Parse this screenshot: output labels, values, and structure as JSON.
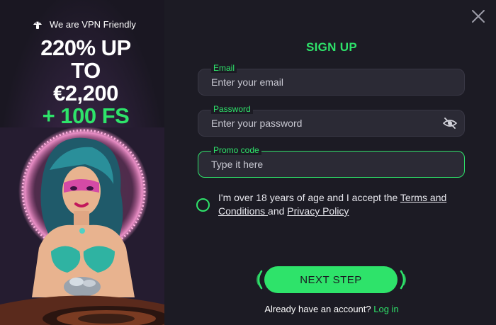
{
  "promo": {
    "vpn_text": "We are VPN Friendly",
    "line1": "220% UP",
    "line2": "TO",
    "line3": "€2,200",
    "line4": "+ 100 FS"
  },
  "form": {
    "title": "SIGN UP",
    "email": {
      "label": "Email",
      "placeholder": "Enter your email"
    },
    "password": {
      "label": "Password",
      "placeholder": "Enter your password"
    },
    "promo": {
      "label": "Promo code",
      "placeholder": "Type it here"
    },
    "terms": {
      "prefix": "I'm over 18 years of age and I accept the ",
      "terms_link": "Terms and Conditions ",
      "middle": "and ",
      "privacy_link": "Privacy Policy"
    },
    "next_label": "NEXT STEP",
    "login_prefix": "Already have an account? ",
    "login_link": "Log in"
  },
  "colors": {
    "accent": "#2ee36a",
    "background": "#1c1b24",
    "field": "#2b2a35"
  },
  "icons": [
    "mushroom-icon",
    "close-icon",
    "eye-off-icon"
  ]
}
